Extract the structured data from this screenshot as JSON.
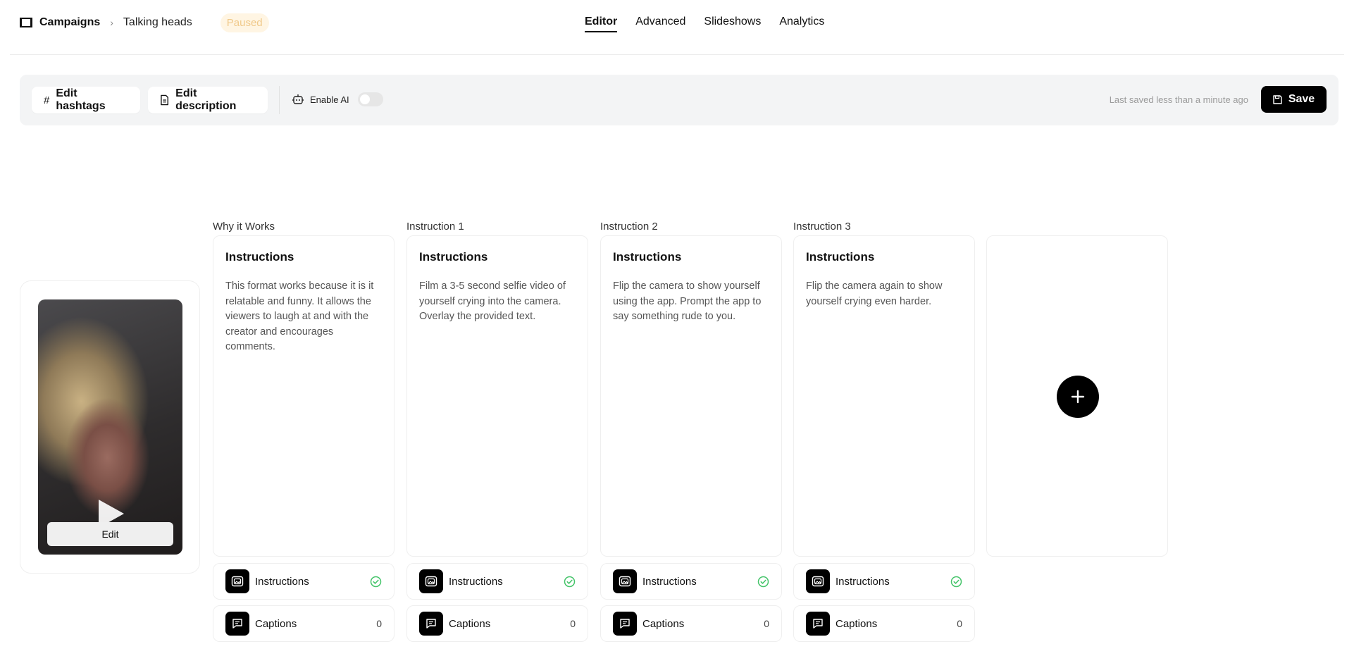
{
  "header": {
    "breadcrumb_root": "Campaigns",
    "breadcrumb_current": "Talking heads",
    "status": "Paused",
    "tabs": [
      {
        "label": "Editor",
        "active": true
      },
      {
        "label": "Advanced",
        "active": false
      },
      {
        "label": "Slideshows",
        "active": false
      },
      {
        "label": "Analytics",
        "active": false
      }
    ]
  },
  "toolbar": {
    "edit_hashtags_label": "Edit hashtags",
    "edit_description_label": "Edit description",
    "enable_ai_label": "Enable AI",
    "enable_ai_on": false,
    "last_saved": "Last saved less than a minute ago",
    "save_label": "Save"
  },
  "preview": {
    "edit_label": "Edit"
  },
  "columns": [
    {
      "title": "Why it Works",
      "heading": "Instructions",
      "text": "This format works because it is it relatable and funny. It allows the viewers to laugh at and with the creator and encourages comments.",
      "instructions_label": "Instructions",
      "captions_label": "Captions",
      "captions_count": "0"
    },
    {
      "title": "Instruction 1",
      "heading": "Instructions",
      "text": "Film a 3-5 second selfie video of yourself crying into the camera. Overlay the provided text.",
      "instructions_label": "Instructions",
      "captions_label": "Captions",
      "captions_count": "0"
    },
    {
      "title": "Instruction 2",
      "heading": "Instructions",
      "text": "Flip the camera to show yourself using the app. Prompt the app to say something rude to you.",
      "instructions_label": "Instructions",
      "captions_label": "Captions",
      "captions_count": "0"
    },
    {
      "title": "Instruction 3",
      "heading": "Instructions",
      "text": "Flip the camera again to show yourself crying even harder.",
      "instructions_label": "Instructions",
      "captions_label": "Captions",
      "captions_count": "0"
    }
  ],
  "colors": {
    "accent": "#000000",
    "status_badge_bg": "#fff5e3",
    "status_badge_text": "#f0c98a",
    "check_green": "#45c46a"
  },
  "icons": {
    "breadcrumb": "film-icon",
    "hashtags": "hash-icon",
    "description": "document-icon",
    "ai": "robot-icon",
    "save": "floppy-disk-icon",
    "instructions": "image-icon",
    "instructions_status": "check-circle-icon",
    "captions": "message-icon",
    "add": "plus-icon"
  }
}
